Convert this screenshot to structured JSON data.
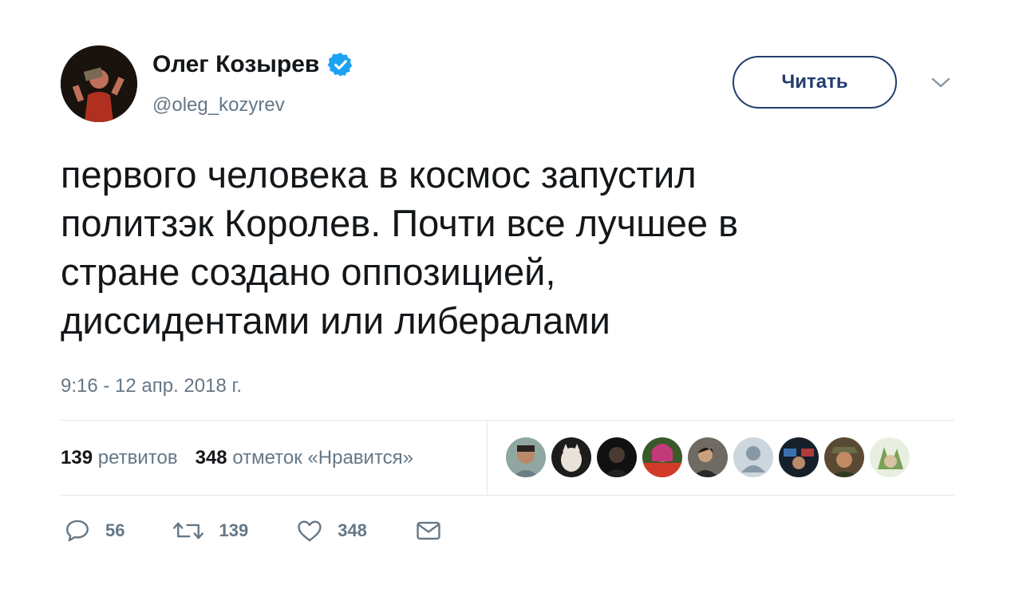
{
  "author": {
    "name": "Олег Козырев",
    "handle": "@oleg_kozyrev",
    "verified": true
  },
  "follow_button": {
    "label": "Читать"
  },
  "tweet": {
    "text": "первого человека в космос запустил\nполитзэк Королев. Почти все лучшее в\nстране создано оппозицией,\nдиссидентами или либералами",
    "timestamp": "9:16 - 12 апр. 2018 г."
  },
  "stats": {
    "retweets_count": "139",
    "retweets_label": "ретвитов",
    "likes_count": "348",
    "likes_label": "отметок «Нравится»"
  },
  "actions": {
    "reply_count": "56",
    "retweet_count": "139",
    "like_count": "348"
  },
  "colors": {
    "verified": "#1da1f2",
    "follow_border": "#233d6e",
    "muted": "#657786",
    "divider": "#e1e8ed"
  },
  "icons": [
    "verified-badge-icon",
    "chevron-down-icon",
    "reply-icon",
    "retweet-icon",
    "heart-icon",
    "envelope-icon"
  ]
}
